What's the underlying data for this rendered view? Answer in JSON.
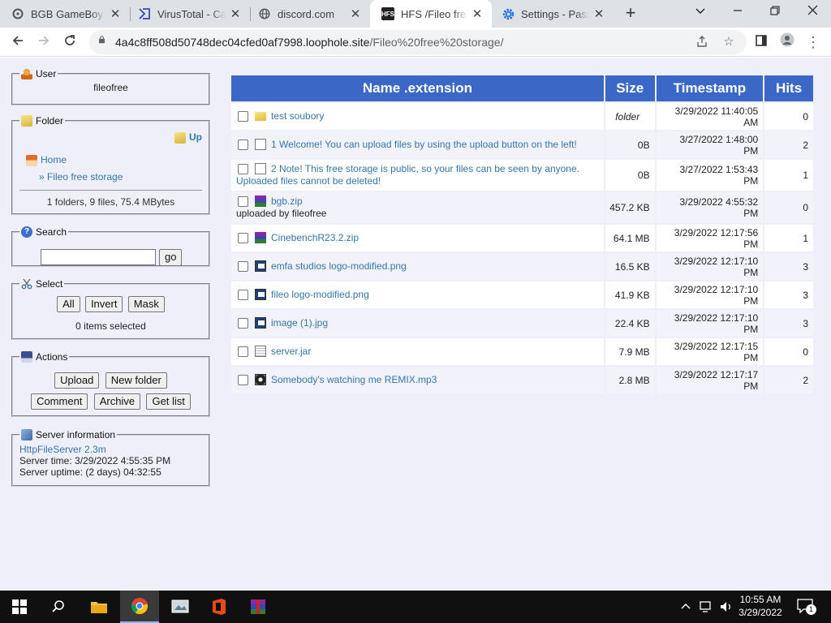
{
  "browser": {
    "tabs": [
      {
        "title": "BGB GameBoy E",
        "favicon": "gear-icon"
      },
      {
        "title": "VirusTotal - Cap",
        "favicon": "virustotal-icon"
      },
      {
        "title": "discord.com",
        "favicon": "globe-icon"
      },
      {
        "title": "HFS /Fileo free s",
        "favicon": "hfs-icon",
        "active": true
      },
      {
        "title": "Settings - Passw",
        "favicon": "gear-icon"
      }
    ],
    "url_host": "4a4c8ff508d50748dec04cfed0af7998.loophole.site",
    "url_path": "/Fileo%20free%20storage/"
  },
  "sidebar": {
    "user": {
      "legend": "User",
      "name": "fileofree"
    },
    "folder": {
      "legend": "Folder",
      "up": "Up",
      "home": "Home",
      "current": "» Fileo free storage",
      "summary": "1 folders, 9 files, 75.4 MBytes"
    },
    "search": {
      "legend": "Search",
      "go": "go"
    },
    "select": {
      "legend": "Select",
      "all": "All",
      "invert": "Invert",
      "mask": "Mask",
      "status": "0 items selected"
    },
    "actions": {
      "legend": "Actions",
      "upload": "Upload",
      "new_folder": "New folder",
      "comment": "Comment",
      "archive": "Archive",
      "get_list": "Get list"
    },
    "server": {
      "legend": "Server information",
      "software": "HttpFileServer 2.3m",
      "time": "Server time: 3/29/2022 4:55:35 PM",
      "uptime": "Server uptime: (2 days) 04:32:55"
    }
  },
  "table": {
    "headers": [
      "Name .extension",
      "Size",
      "Timestamp",
      "Hits"
    ],
    "rows": [
      {
        "name": "test soubory",
        "note": "",
        "size": "folder",
        "ts1": "3/29/2022 11:40:05",
        "ts2": "AM",
        "hits": "0",
        "icon": "folder-icon"
      },
      {
        "name": "1 Welcome! You can upload files by using the upload button on the left!",
        "note": "",
        "size": "0B",
        "ts1": "3/27/2022 1:48:00",
        "ts2": "PM",
        "hits": "2",
        "icon": "file-icon"
      },
      {
        "name": "2 Note! This free storage is public, so your files can be seen by anyone.",
        "note": "Uploaded files cannot be deleted!",
        "size": "0B",
        "ts1": "3/27/2022 1:53:43",
        "ts2": "PM",
        "hits": "1",
        "icon": "file-icon"
      },
      {
        "name": "bgb.zip",
        "note": "uploaded by fileofree",
        "size": "457.2 KB",
        "ts1": "3/29/2022 4:55:32",
        "ts2": "PM",
        "hits": "0",
        "icon": "archive-icon"
      },
      {
        "name": "CinebenchR23.2.zip",
        "note": "",
        "size": "64.1 MB",
        "ts1": "3/29/2022 12:17:56",
        "ts2": "PM",
        "hits": "1",
        "icon": "archive-icon"
      },
      {
        "name": "emfa studios logo-modified.png",
        "note": "",
        "size": "16.5 KB",
        "ts1": "3/29/2022 12:17:10",
        "ts2": "PM",
        "hits": "3",
        "icon": "image-icon"
      },
      {
        "name": "fileo logo-modified.png",
        "note": "",
        "size": "41.9 KB",
        "ts1": "3/29/2022 12:17:10",
        "ts2": "PM",
        "hits": "3",
        "icon": "image-icon"
      },
      {
        "name": "image (1).jpg",
        "note": "",
        "size": "22.4 KB",
        "ts1": "3/29/2022 12:17:10",
        "ts2": "PM",
        "hits": "3",
        "icon": "image-icon"
      },
      {
        "name": "server.jar",
        "note": "",
        "size": "7.9 MB",
        "ts1": "3/29/2022 12:17:15",
        "ts2": "PM",
        "hits": "0",
        "icon": "jar-icon"
      },
      {
        "name": "Somebody's watching me REMIX.mp3",
        "note": "",
        "size": "2.8 MB",
        "ts1": "3/29/2022 12:17:17",
        "ts2": "PM",
        "hits": "2",
        "icon": "audio-icon"
      }
    ]
  },
  "taskbar": {
    "time": "10:55 AM",
    "date": "3/29/2022",
    "notifications": "1"
  }
}
